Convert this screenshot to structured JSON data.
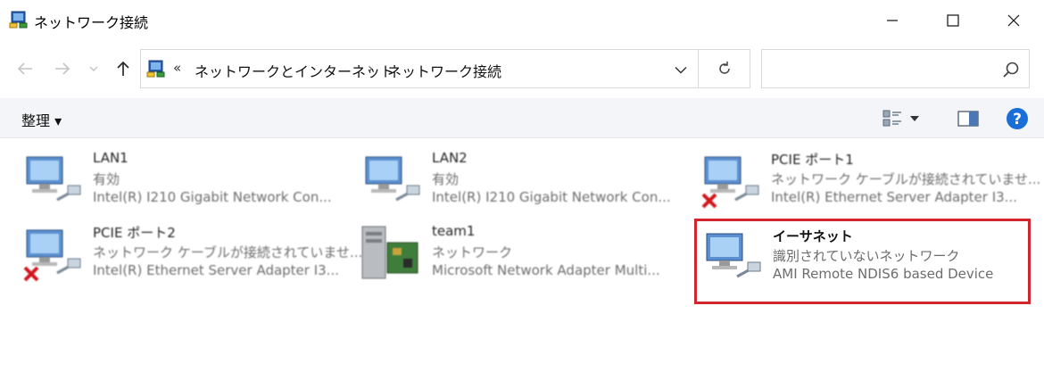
{
  "window": {
    "title": "ネットワーク接続"
  },
  "address": {
    "chevron": "«",
    "segment1": "ネットワークとインターネット",
    "separator": "›",
    "segment2": "ネットワーク接続"
  },
  "search": {
    "placeholder": ""
  },
  "toolbar": {
    "organize_label": "整理 ▾"
  },
  "connections": [
    {
      "name": "LAN1",
      "status": "有効",
      "device": "Intel(R) I210 Gigabit Network Con...",
      "disabled": false,
      "type": "network"
    },
    {
      "name": "LAN2",
      "status": "有効",
      "device": "Intel(R) I210 Gigabit Network Con...",
      "disabled": false,
      "type": "network"
    },
    {
      "name": "PCIE ポート1",
      "status": "ネットワーク ケーブルが接続されていませ...",
      "device": "Intel(R) Ethernet Server Adapter I3...",
      "disabled": true,
      "type": "network"
    },
    {
      "name": "PCIE ポート2",
      "status": "ネットワーク ケーブルが接続されていませ...",
      "device": "Intel(R) Ethernet Server Adapter I3...",
      "disabled": true,
      "type": "network"
    },
    {
      "name": "team1",
      "status": "ネットワーク",
      "device": "Microsoft Network Adapter Multi...",
      "disabled": false,
      "type": "team"
    },
    {
      "name": "イーサネット",
      "status": "識別されていないネットワーク",
      "device": "AMI Remote NDIS6 based Device",
      "disabled": false,
      "type": "network"
    }
  ],
  "colors": {
    "highlight": "#d2262e",
    "help": "#1a6ed8"
  },
  "icons": [
    "network-connections-icon",
    "minimize-icon",
    "maximize-icon",
    "close-icon",
    "back-arrow-icon",
    "forward-arrow-icon",
    "up-arrow-icon",
    "refresh-icon",
    "search-icon",
    "view-options-icon",
    "preview-pane-icon",
    "help-icon"
  ]
}
